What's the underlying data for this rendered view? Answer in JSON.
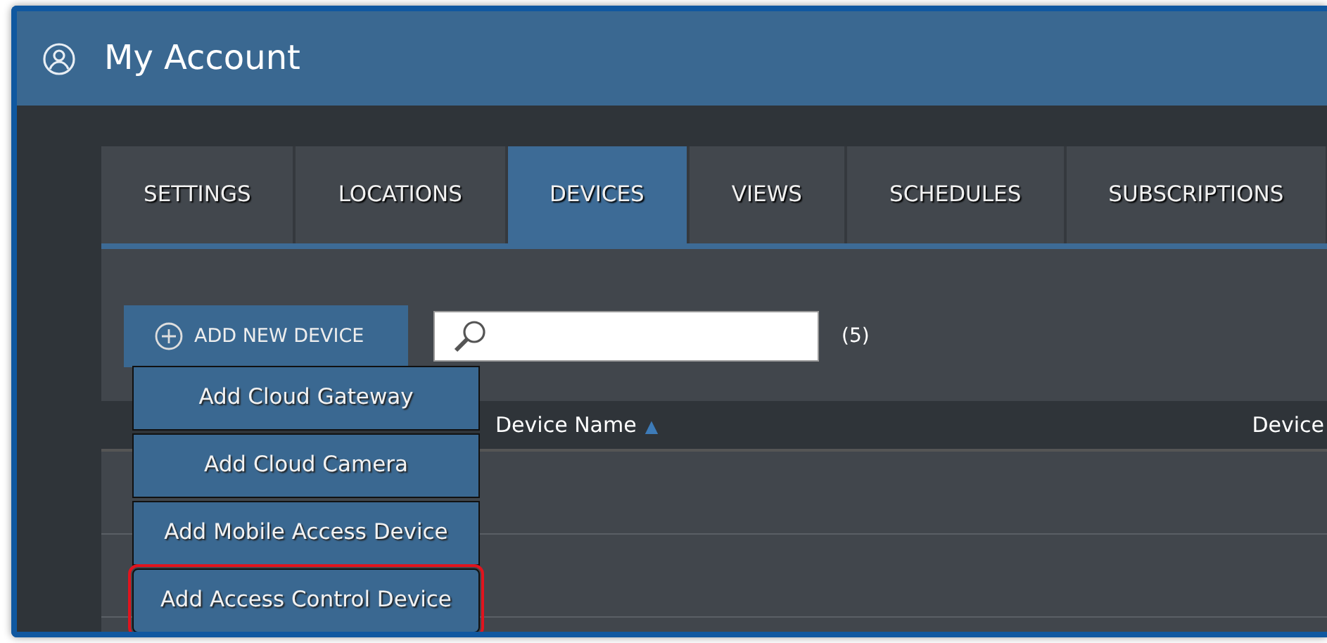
{
  "window": {
    "title": "My Account"
  },
  "tabs": [
    {
      "label": "SETTINGS",
      "selected": false
    },
    {
      "label": "LOCATIONS",
      "selected": false
    },
    {
      "label": "DEVICES",
      "selected": true
    },
    {
      "label": "VIEWS",
      "selected": false
    },
    {
      "label": "SCHEDULES",
      "selected": false
    },
    {
      "label": "SUBSCRIPTIONS",
      "selected": false
    }
  ],
  "add_button": {
    "label": "ADD NEW DEVICE"
  },
  "device_count": "(5)",
  "table": {
    "columns": [
      {
        "label": "Device Name",
        "sort_icon": "▲"
      },
      {
        "label": "Device"
      }
    ]
  },
  "menu": {
    "items": [
      {
        "label": "Add Cloud Gateway",
        "outlined": false
      },
      {
        "label": "Add Cloud Camera",
        "outlined": false
      },
      {
        "label": "Add Mobile Access Device",
        "outlined": false
      },
      {
        "label": "Add Access Control Device",
        "outlined": true
      }
    ]
  }
}
